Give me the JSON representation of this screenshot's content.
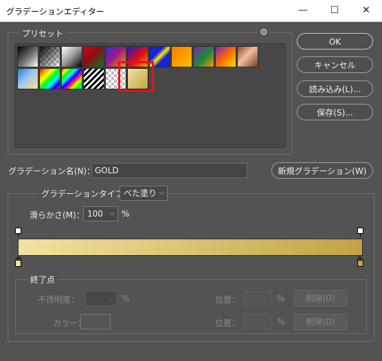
{
  "window": {
    "title": "グラデーションエディター",
    "minimize": "—",
    "maximize": "☐",
    "close": "✕"
  },
  "presets": {
    "legend": "プリセット",
    "gear_icon": "gear-icon",
    "gear_glyph": "⚙",
    "selected_index": 17
  },
  "buttons": {
    "ok": "OK",
    "cancel": "キャンセル",
    "load": "読み込み(L)...",
    "save": "保存(S)...",
    "new_gradient": "新規グラデーション(W)"
  },
  "name_field": {
    "label": "グラデーション名(N)：",
    "value": "GOLD"
  },
  "gradient_type": {
    "label": "グラデーションタイプ：",
    "value": "べた塗り"
  },
  "smoothness": {
    "label": "滑らかさ(M)：",
    "value": "100",
    "unit": "%"
  },
  "gradient": {
    "start_color": "#f1e3a0",
    "end_color": "#c3a245"
  },
  "stops": {
    "legend": "終了点",
    "opacity_label": "不透明度：",
    "opacity_unit": "%",
    "position_label": "位置：",
    "position_unit": "%",
    "delete_label": "削除(D)",
    "color_label": "カラー：",
    "position2_label": "位置：",
    "position2_unit": "%",
    "delete2_label": "削除(D)"
  }
}
